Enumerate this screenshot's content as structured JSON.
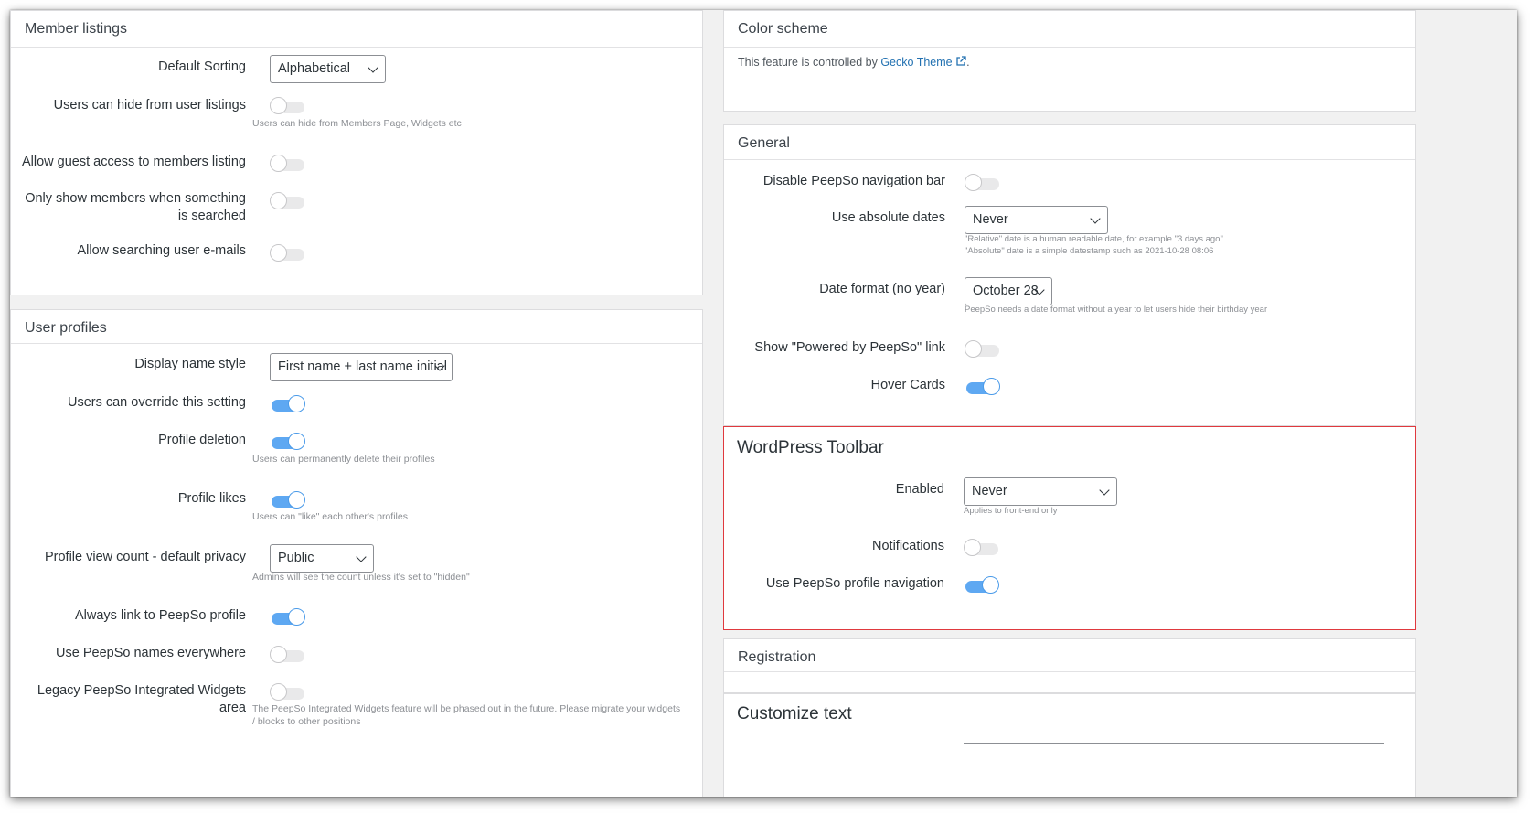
{
  "member_listings": {
    "title": "Member listings",
    "default_sorting": {
      "label": "Default Sorting",
      "value": "Alphabetical"
    },
    "hide_from_listings": {
      "label": "Users can hide from user listings",
      "on": false,
      "help": "Users can hide from Members Page, Widgets etc"
    },
    "guest_access": {
      "label": "Allow guest access to members listing",
      "on": false
    },
    "only_show_searched": {
      "label_line1": "Only show members when something",
      "label_line2": "is searched",
      "on": false
    },
    "search_emails": {
      "label": "Allow searching user e-mails",
      "on": false
    }
  },
  "user_profiles": {
    "title": "User profiles",
    "display_name_style": {
      "label": "Display name style",
      "value": "First name + last name initial"
    },
    "override_setting": {
      "label": "Users can override this setting",
      "on": true
    },
    "profile_deletion": {
      "label": "Profile deletion",
      "on": true,
      "help": "Users can permanently delete their profiles"
    },
    "profile_likes": {
      "label": "Profile likes",
      "on": true,
      "help": "Users can \"like\" each other's profiles"
    },
    "view_count_privacy": {
      "label": "Profile view count - default privacy",
      "value": "Public",
      "help": "Admins will see the count unless it's set to \"hidden\""
    },
    "always_link": {
      "label": "Always link to PeepSo profile",
      "on": true
    },
    "names_everywhere": {
      "label": "Use PeepSo names everywhere",
      "on": false
    },
    "legacy_widgets": {
      "label_line1": "Legacy PeepSo Integrated Widgets",
      "label_line2": "area",
      "on": false,
      "help": "The PeepSo Integrated Widgets feature will be phased out in the future. Please migrate your widgets / blocks to other positions"
    }
  },
  "color_scheme": {
    "title": "Color scheme",
    "text_before": "This feature is controlled by ",
    "link_text": "Gecko Theme",
    "text_after": "."
  },
  "general": {
    "title": "General",
    "disable_nav": {
      "label": "Disable PeepSo navigation bar",
      "on": false
    },
    "absolute_dates": {
      "label": "Use absolute dates",
      "value": "Never",
      "help_line1": "\"Relative\" date is a human readable date, for example \"3 days ago\"",
      "help_line2": "\"Absolute\" date is a simple datestamp such as 2021-10-28 08:06"
    },
    "date_format": {
      "label": "Date format (no year)",
      "value": "October 28",
      "help": "PeepSo needs a date format without a year to let users hide their birthday year"
    },
    "powered_by": {
      "label": "Show \"Powered by PeepSo\" link",
      "on": false
    },
    "hover_cards": {
      "label": "Hover Cards",
      "on": true
    }
  },
  "wp_toolbar": {
    "title": "WordPress Toolbar",
    "highlight_color": "#e0393e",
    "enabled": {
      "label": "Enabled",
      "value": "Never",
      "help": "Applies to front-end only"
    },
    "notifications": {
      "label": "Notifications",
      "on": false
    },
    "profile_nav": {
      "label": "Use PeepSo profile navigation",
      "on": true
    }
  },
  "registration": {
    "title": "Registration"
  },
  "customize_text": {
    "title": "Customize text"
  },
  "colors": {
    "toggle_on": "#5ea8f2",
    "link": "#2271b1"
  }
}
